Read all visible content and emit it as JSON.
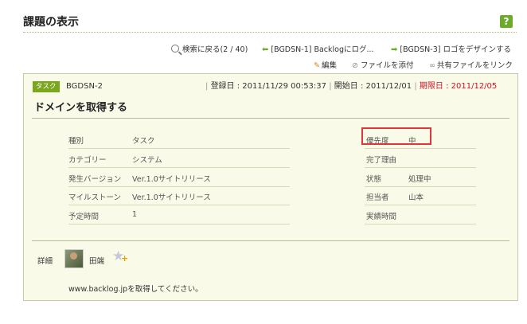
{
  "page": {
    "title": "課題の表示",
    "help_label": "?"
  },
  "nav": {
    "back_label": "検索に戻る(2 / 40)",
    "prev_label": "[BGDSN-1] Backlogにログ...",
    "next_label": "[BGDSN-3] ロゴをデザインする"
  },
  "actions": {
    "edit_label": "編集",
    "attach_label": "ファイルを添付",
    "share_label": "共有ファイルをリンク"
  },
  "issue": {
    "type_tag": "タスク",
    "key": "BGDSN-2",
    "registered": "登録日 : 2011/11/29 00:53:37",
    "start": "開始日 : 2011/12/01",
    "due": "期限日 : 2011/12/05",
    "summary": "ドメインを取得する"
  },
  "fields_left": [
    {
      "label": "種別",
      "value": "タスク"
    },
    {
      "label": "カテゴリー",
      "value": "システム"
    },
    {
      "label": "発生バージョン",
      "value": "Ver.1.0サイトリリース"
    },
    {
      "label": "マイルストーン",
      "value": "Ver.1.0サイトリリース"
    },
    {
      "label": "予定時間",
      "value": "1"
    }
  ],
  "fields_right": [
    {
      "label": "優先度",
      "value": "中"
    },
    {
      "label": "完了理由",
      "value": ""
    },
    {
      "label": "状態",
      "value": "処理中"
    },
    {
      "label": "担当者",
      "value": "山本"
    },
    {
      "label": "実績時間",
      "value": ""
    }
  ],
  "detail": {
    "label": "詳細",
    "user": "田端",
    "description": "www.backlog.jpを取得してください。"
  },
  "colors": {
    "accent_green": "#7aa71e",
    "due_red": "#d0102a",
    "highlight_red": "#e0353a",
    "panel_bg": "#fafae8"
  }
}
